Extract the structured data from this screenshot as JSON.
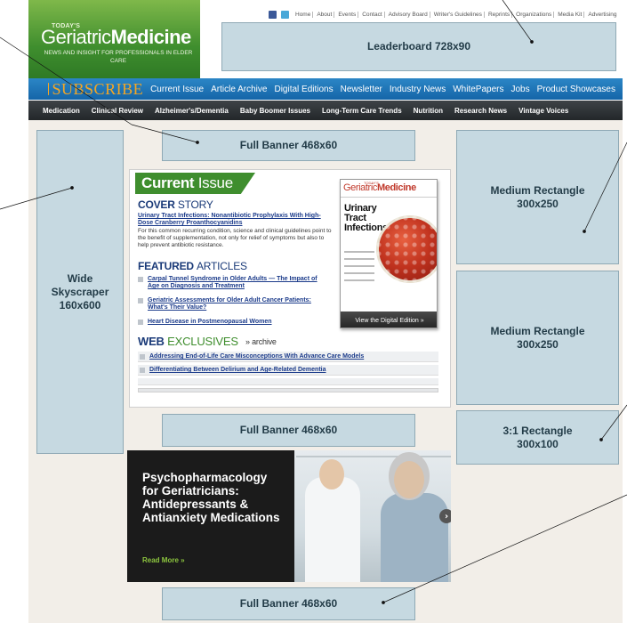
{
  "header": {
    "logo": {
      "small": "TODAY'S",
      "name_light": "Geriatric",
      "name_bold": "Medicine",
      "tagline": "NEWS AND INSIGHT FOR PROFESSIONALS IN ELDER CARE"
    },
    "topnav": [
      "Home",
      "About",
      "Events",
      "Contact",
      "Advisory Board",
      "Writer's Guidelines",
      "Reprints",
      "Organizations",
      "Media Kit",
      "Advertising"
    ],
    "social_icons": [
      "facebook-icon",
      "twitter-icon"
    ]
  },
  "ads": {
    "leaderboard": "Leaderboard 728x90",
    "full_banner_top": "Full Banner 468x60",
    "wide_skyscraper": "Wide Skyscraper 160x600",
    "medium_rectangle_1": "Medium Rectangle 300x250",
    "medium_rectangle_2": "Medium Rectangle 300x250",
    "full_banner_mid": "Full Banner 468x60",
    "rect_3_1": "3:1 Rectangle 300x100",
    "full_banner_bottom": "Full Banner 468x60"
  },
  "nav_primary": {
    "subscribe": "SUBSCRIBE",
    "items": [
      "Current Issue",
      "Article Archive",
      "Digital Editions",
      "Newsletter",
      "Industry News",
      "WhitePapers",
      "Jobs",
      "Product Showcases"
    ]
  },
  "nav_secondary": {
    "items": [
      "Medication",
      "Clinical Review",
      "Alzheimer's/Dementia",
      "Baby Boomer Issues",
      "Long-Term Care Trends",
      "Nutrition",
      "Research News",
      "Vintage Voices"
    ]
  },
  "current_issue": {
    "tab_bold": "Current",
    "tab_light": "Issue",
    "cover_story_bold": "COVER",
    "cover_story_light": "STORY",
    "cover_story_title": "Urinary Tract Infections: Nonantibiotic Prophylaxis With High-Dose Cranberry Proanthocyanidins",
    "cover_story_text": "For this common recurring condition, science and clinical guidelines point to the benefit of supplementation, not only for relief of symptoms but also to help prevent antibiotic resistance.",
    "featured_bold": "FEATURED",
    "featured_light": "ARTICLES",
    "featured_articles": [
      "Carpal Tunnel Syndrome in Older Adults — The Impact of Age on Diagnosis and Treatment",
      "Geriatric Assessments for Older Adult Cancer Patients: What's Their Value?",
      "Heart Disease in Postmenopausal Women"
    ],
    "web_bold": "WEB",
    "web_light": "EXCLUSIVES",
    "archive": "» archive",
    "web_exclusives": [
      "Addressing End-of-Life Care Misconceptions With Advance Care Models",
      "Differentiating Between Delirium and Age-Related Dementia"
    ],
    "cover": {
      "mast_light": "Geriatric",
      "mast_bold": "Medicine",
      "mast_small": "TODAY'S",
      "title": "Urinary Tract Infections",
      "button": "View the Digital Edition »"
    }
  },
  "promo": {
    "headline": "Psychopharmacology for Geriatricians: Antidepressants & Antianxiety Medications",
    "read_more": "Read More »"
  }
}
